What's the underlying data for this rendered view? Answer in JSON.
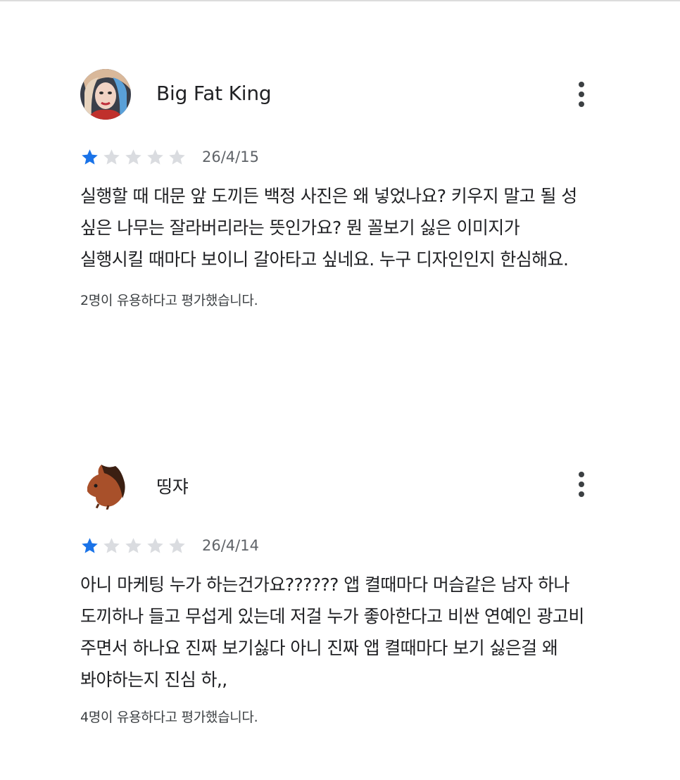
{
  "reviews": [
    {
      "author": "Big Fat King",
      "avatar_icon": "profile-photo-avatar",
      "rating": 1,
      "max_rating": 5,
      "date": "26/4/15",
      "body_lines": [
        "실행할 때 대문 앞 도끼든 백정 사진은 왜 넣었나요? 키우지 말고 될 성",
        "싶은 나무는 잘라버리라는 뜻인가요? 뭔 꼴보기 싫은 이미지가",
        "실행시킬 때마다 보이니 갈아타고 싶네요. 누구 디자인인지 한심해요."
      ],
      "helpful_text": "2명이 유용하다고 평가했습니다."
    },
    {
      "author": "띵쟈",
      "avatar_icon": "horse-avatar",
      "rating": 1,
      "max_rating": 5,
      "date": "26/4/14",
      "body_lines": [
        "아니 마케팅 누가 하는건가요?????? 앱 켤때마다 머슴같은 남자 하나",
        "도끼하나 들고 무섭게 있는데 저걸 누가 좋아한다고 비싼 연예인 광고비",
        "주면서 하나요 진짜 보기싫다 아니 진짜 앱 켤때마다 보기 싫은걸 왜",
        "봐야하는지 진심 하,,"
      ],
      "helpful_text": "4명이 유용하다고 평가했습니다."
    }
  ],
  "colors": {
    "star_filled": "#1a73e8",
    "star_empty": "#dadce0",
    "text_primary": "#202124",
    "text_secondary": "#5f6368"
  }
}
